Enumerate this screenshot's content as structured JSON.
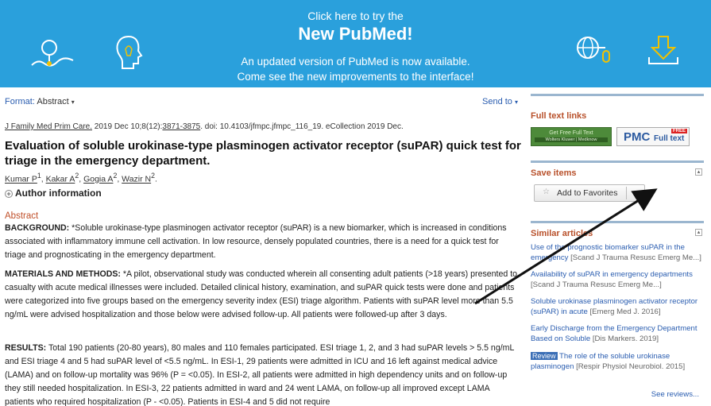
{
  "banner": {
    "line1": "Click here to try the",
    "line2": "New PubMed!",
    "line3": "An updated version of PubMed is now available.",
    "line4": "Come see the new improvements to the interface!",
    "icons": [
      "magnifier-icon",
      "lightbulb-head-icon",
      "globe-mouse-icon",
      "download-icon"
    ]
  },
  "toolbar": {
    "format_label": "Format:",
    "format_value": "Abstract",
    "send_to": "Send to"
  },
  "citation": {
    "journal": "J Family Med Prim Care.",
    "date_vol": " 2019 Dec 10;8(12):",
    "pages": "3871-3875",
    "doi": ". doi: 10.4103/jfmpc.jfmpc_116_19. eCollection 2019 Dec."
  },
  "article": {
    "title": "Evaluation of soluble urokinase-type plasminogen activator receptor (suPAR) quick test for triage in the emergency department.",
    "authors": [
      {
        "name": "Kumar P",
        "sup": "1"
      },
      {
        "name": "Kakar A",
        "sup": "2"
      },
      {
        "name": "Gogia A",
        "sup": "2"
      },
      {
        "name": "Wazir N",
        "sup": "2"
      }
    ],
    "author_info": "Author information",
    "abstract_heading": "Abstract",
    "background_label": "BACKGROUND:",
    "background_text": " *Soluble urokinase-type plasminogen activator receptor (suPAR) is a new biomarker, which is increased in conditions associated with inflammatory immune cell activation. In low resource, densely populated countries, there is a need for a quick test for triage and prognosticating in the emergency department.",
    "methods_label": "MATERIALS AND METHODS:",
    "methods_text": " *A pilot, observational study was conducted wherein all consenting adult patients (>18 years) presented to casualty with acute medical illnesses were included. Detailed clinical history, examination, and suPAR quick tests were done and patients were categorized into five groups based on the emergency severity index (ESI) triage algorithm. Patients with suPAR level more than 5.5 ng/mL were advised hospitalization and those below were advised follow-up. All patients were followed-up after 3 days.",
    "results_label": "RESULTS:",
    "results_text": " Total 190 patients (20-80 years), 80 males and 110 females participated. ESI triage 1, 2, and 3 had suPAR levels > 5.5 ng/mL and ESI triage 4 and 5 had suPAR level of <5.5 ng/mL. In ESI-1, 29 patients were admitted in ICU and 16 left against medical advice (LAMA) and on follow-up mortality was 96% (P = <0.05). In ESI-2, all patients were admitted in high dependency units and on follow-up they still needed hospitalization. In ESI-3, 22 patients admitted in ward and 24 went LAMA, on follow-up all improved except LAMA patients who required hospitalization (P - <0.05). Patients in ESI-4 and 5 did not require"
  },
  "sidebar": {
    "full_text_heading": "Full text links",
    "wk_line1": "Get Free Full Text",
    "wk_line2": "Wolters Kluwer | Medknow",
    "pmc_label": "PMC",
    "pmc_fulltext": "Full text",
    "pmc_free": "FREE",
    "save_heading": "Save items",
    "add_favorites": "Add to Favorites",
    "similar_heading": "Similar articles",
    "similar": [
      {
        "title": "Use of the prognostic biomarker suPAR in the emergency",
        "journal": " [Scand J Trauma Resusc Emerg Me...]"
      },
      {
        "title": "Availability of suPAR in emergency departments",
        "journal": " [Scand J Trauma Resusc Emerg Me...]"
      },
      {
        "title": "Soluble urokinase plasminogen activator receptor (suPAR) in acute",
        "journal": " [Emerg Med J. 2016]"
      },
      {
        "title": "Early Discharge from the Emergency Department Based on Soluble",
        "journal": " [Dis Markers. 2019]"
      },
      {
        "badge": "Review",
        "title": " The role of the soluble urokinase plasminogen",
        "journal": " [Respir Physiol Neurobiol. 2015]"
      }
    ],
    "see_reviews": "See reviews..."
  },
  "colors": {
    "banner": "#2aa0dc",
    "link": "#2a5db0",
    "heading_accent": "#b8502a"
  }
}
